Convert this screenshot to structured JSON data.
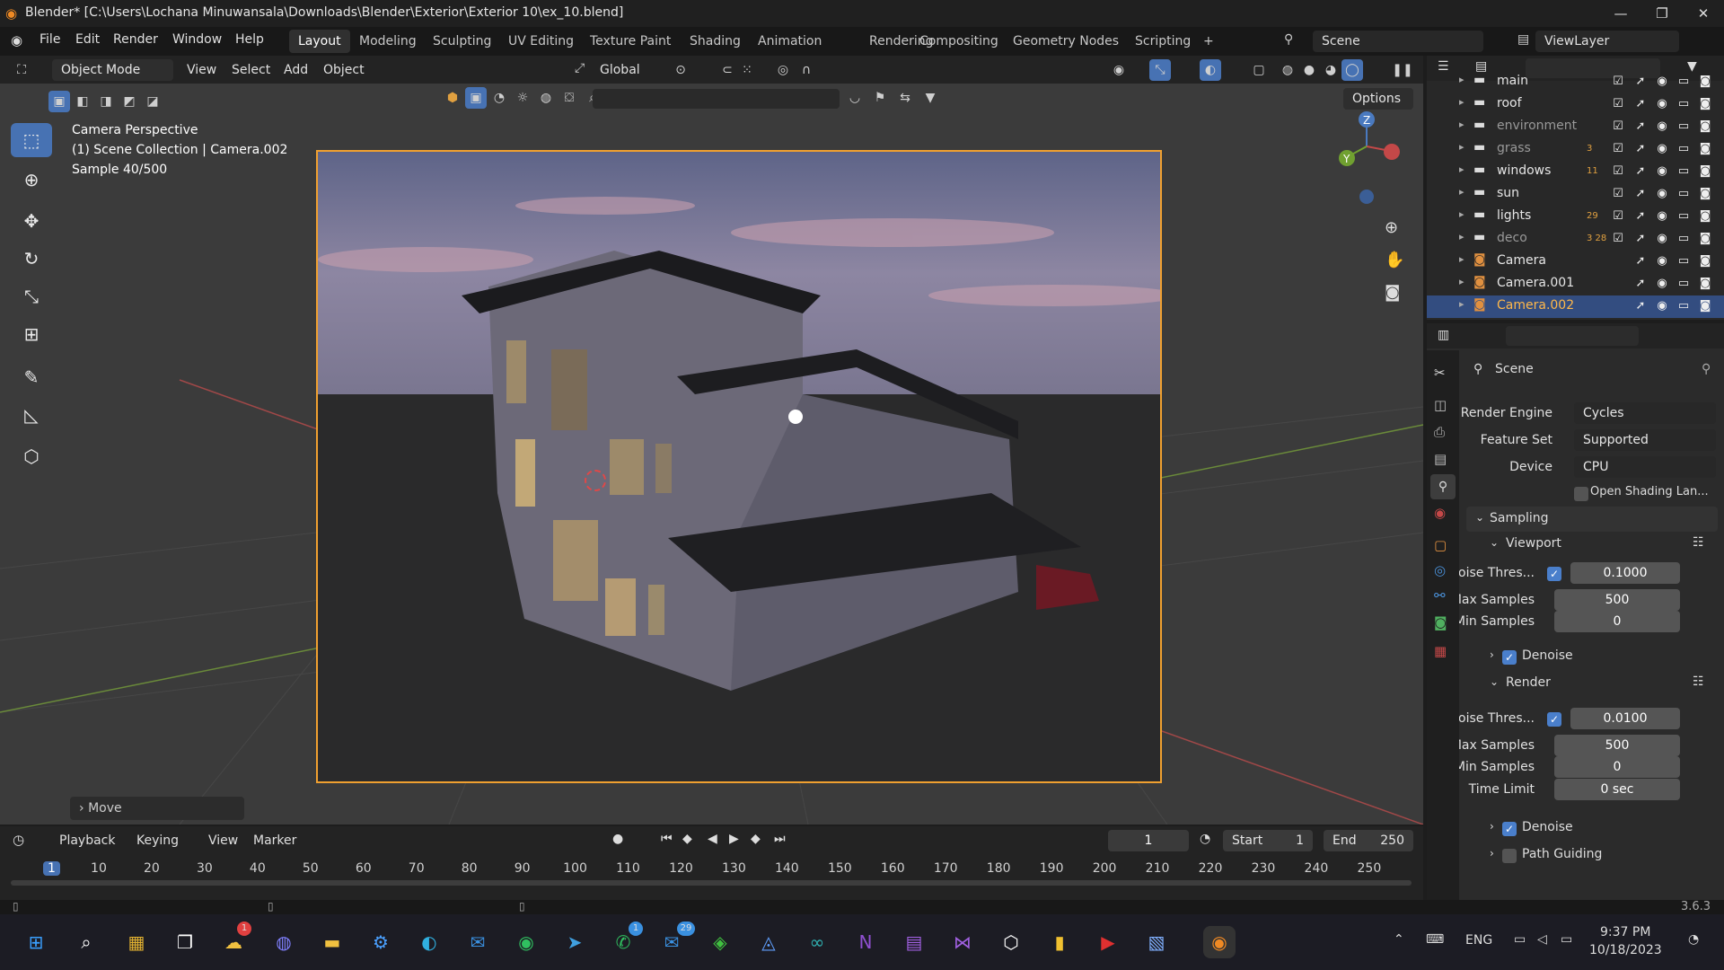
{
  "titlebar": {
    "title": "Blender* [C:\\Users\\Lochana Minuwansala\\Downloads\\Blender\\Exterior\\Exterior 10\\ex_10.blend]",
    "minimize": "—",
    "restore": "❐",
    "close": "✕"
  },
  "menu": [
    "File",
    "Edit",
    "Render",
    "Window",
    "Help"
  ],
  "workspaces": [
    "Layout",
    "Modeling",
    "Sculpting",
    "UV Editing",
    "Texture Paint",
    "Shading",
    "Animation",
    "Rendering",
    "Compositing",
    "Geometry Nodes",
    "Scripting",
    "+"
  ],
  "scene": {
    "name": "Scene",
    "viewlayer": "ViewLayer"
  },
  "viewport_header": {
    "mode": "Object Mode",
    "view": "View",
    "select": "Select",
    "add": "Add",
    "object": "Object",
    "orientation": "Global",
    "options": "Options"
  },
  "overlay": {
    "line1": "Camera Perspective",
    "line2": "(1) Scene Collection | Camera.002",
    "line3": "Sample 40/500",
    "last_op": "Move"
  },
  "outliner": [
    {
      "name": "main",
      "level": 2
    },
    {
      "name": "roof",
      "level": 1
    },
    {
      "name": "environment",
      "level": 1
    },
    {
      "name": "grass",
      "level": 1,
      "badge": "3"
    },
    {
      "name": "windows",
      "level": 1,
      "badge": "11"
    },
    {
      "name": "sun",
      "level": 1
    },
    {
      "name": "lights",
      "level": 1,
      "badge": "29"
    },
    {
      "name": "deco",
      "level": 1,
      "badge": "3 28"
    },
    {
      "name": "Camera",
      "level": 1
    },
    {
      "name": "Camera.001",
      "level": 1
    },
    {
      "name": "Camera.002",
      "level": 1
    }
  ],
  "properties": {
    "context": "Scene",
    "render_engine_label": "Render Engine",
    "render_engine": "Cycles",
    "feature_set_label": "Feature Set",
    "feature_set": "Supported",
    "device_label": "Device",
    "device": "CPU",
    "osl": "Open Shading Lan...",
    "sampling": "Sampling",
    "viewport": "Viewport",
    "vp_noise_label": "Noise Thres...",
    "vp_noise": "0.1000",
    "vp_max_label": "Max Samples",
    "vp_max": "500",
    "vp_min_label": "Min Samples",
    "vp_min": "0",
    "vp_denoise": "Denoise",
    "render": "Render",
    "r_noise_label": "Noise Thres...",
    "r_noise": "0.0100",
    "r_max_label": "Max Samples",
    "r_max": "500",
    "r_min_label": "Min Samples",
    "r_min": "0",
    "r_time_label": "Time Limit",
    "r_time": "0 sec",
    "r_denoise": "Denoise",
    "path_guiding": "Path Guiding"
  },
  "timeline": {
    "playback": "Playback",
    "keying": "Keying",
    "view": "View",
    "marker": "Marker",
    "current": "1",
    "start_label": "Start",
    "start": "1",
    "end_label": "End",
    "end": "250",
    "ticks": [
      "1",
      "10",
      "20",
      "30",
      "40",
      "50",
      "60",
      "70",
      "80",
      "90",
      "100",
      "110",
      "120",
      "130",
      "140",
      "150",
      "160",
      "170",
      "180",
      "190",
      "200",
      "210",
      "220",
      "230",
      "240",
      "250"
    ]
  },
  "status": {
    "version": "3.6.3"
  },
  "taskbar": {
    "lang": "ENG",
    "time": "9:37 PM",
    "date": "10/18/2023",
    "badge_whatsapp": "1",
    "badge_mail": "29",
    "badge_weather": "1"
  }
}
